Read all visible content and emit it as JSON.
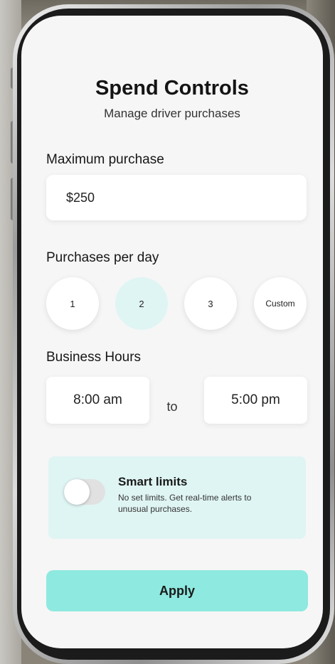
{
  "header": {
    "title": "Spend Controls",
    "subtitle": "Manage driver purchases"
  },
  "max_purchase": {
    "label": "Maximum purchase",
    "value": "$250"
  },
  "per_day": {
    "label": "Purchases per day",
    "options": [
      "1",
      "2",
      "3",
      "Custom"
    ],
    "selected": "2"
  },
  "business_hours": {
    "label": "Business Hours",
    "start": "8:00 am",
    "separator": "to",
    "end": "5:00 pm"
  },
  "smart_limits": {
    "title": "Smart limits",
    "description": "No set limits. Get real-time alerts to unusual purchases.",
    "enabled": false
  },
  "apply_label": "Apply",
  "colors": {
    "accent": "#8ee9e0",
    "accent_light": "#dff5f3",
    "screen_bg": "#f6f6f6"
  }
}
